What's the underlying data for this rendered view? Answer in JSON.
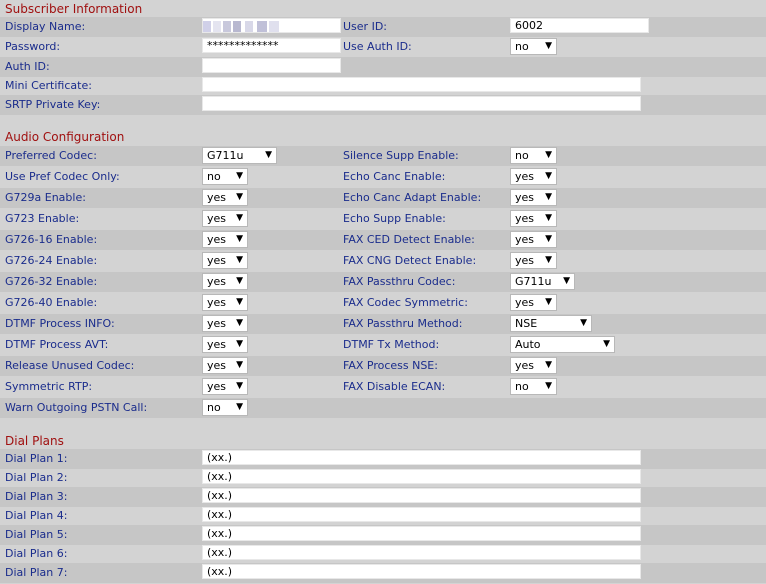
{
  "subscriber": {
    "title": "Subscriber Information",
    "display_name_label": "Display Name:",
    "user_id_label": "User ID:",
    "user_id_value": "6002",
    "password_label": "Password:",
    "password_value": "*************",
    "use_auth_id_label": "Use Auth ID:",
    "use_auth_id_value": "no",
    "auth_id_label": "Auth ID:",
    "mini_cert_label": "Mini Certificate:",
    "srtp_label": "SRTP Private Key:"
  },
  "audio": {
    "title": "Audio Configuration",
    "rows": [
      {
        "left_label": "Preferred Codec:",
        "left_value": "G711u",
        "right_label": "Silence Supp Enable:",
        "right_value": "no"
      },
      {
        "left_label": "Use Pref Codec Only:",
        "left_value": "no",
        "right_label": "Echo Canc Enable:",
        "right_value": "yes"
      },
      {
        "left_label": "G729a Enable:",
        "left_value": "yes",
        "right_label": "Echo Canc Adapt Enable:",
        "right_value": "yes"
      },
      {
        "left_label": "G723 Enable:",
        "left_value": "yes",
        "right_label": "Echo Supp Enable:",
        "right_value": "yes"
      },
      {
        "left_label": "G726-16 Enable:",
        "left_value": "yes",
        "right_label": "FAX CED Detect Enable:",
        "right_value": "yes"
      },
      {
        "left_label": "G726-24 Enable:",
        "left_value": "yes",
        "right_label": "FAX CNG Detect Enable:",
        "right_value": "yes"
      },
      {
        "left_label": "G726-32 Enable:",
        "left_value": "yes",
        "right_label": "FAX Passthru Codec:",
        "right_value": "G711u"
      },
      {
        "left_label": "G726-40 Enable:",
        "left_value": "yes",
        "right_label": "FAX Codec Symmetric:",
        "right_value": "yes"
      },
      {
        "left_label": "DTMF Process INFO:",
        "left_value": "yes",
        "right_label": "FAX Passthru Method:",
        "right_value": "NSE"
      },
      {
        "left_label": "DTMF Process AVT:",
        "left_value": "yes",
        "right_label": "DTMF Tx Method:",
        "right_value": "Auto"
      },
      {
        "left_label": "Release Unused Codec:",
        "left_value": "yes",
        "right_label": "FAX Process NSE:",
        "right_value": "yes"
      },
      {
        "left_label": "Symmetric RTP:",
        "left_value": "yes",
        "right_label": "FAX Disable ECAN:",
        "right_value": "no"
      },
      {
        "left_label": "Warn Outgoing PSTN Call:",
        "left_value": "no"
      }
    ]
  },
  "dial_plans": {
    "title": "Dial Plans",
    "rows": [
      {
        "label": "Dial Plan 1:",
        "value": "(xx.)"
      },
      {
        "label": "Dial Plan 2:",
        "value": "(xx.)"
      },
      {
        "label": "Dial Plan 3:",
        "value": "(xx.)"
      },
      {
        "label": "Dial Plan 4:",
        "value": "(xx.)"
      },
      {
        "label": "Dial Plan 5:",
        "value": "(xx.)"
      },
      {
        "label": "Dial Plan 6:",
        "value": "(xx.)"
      },
      {
        "label": "Dial Plan 7:",
        "value": "(xx.)"
      }
    ]
  },
  "icons": {
    "dropdown": "chevron-down-icon"
  },
  "colors": {
    "background": "#d3d3d3",
    "label": "#1a2c8c",
    "section_title": "#a01010"
  }
}
